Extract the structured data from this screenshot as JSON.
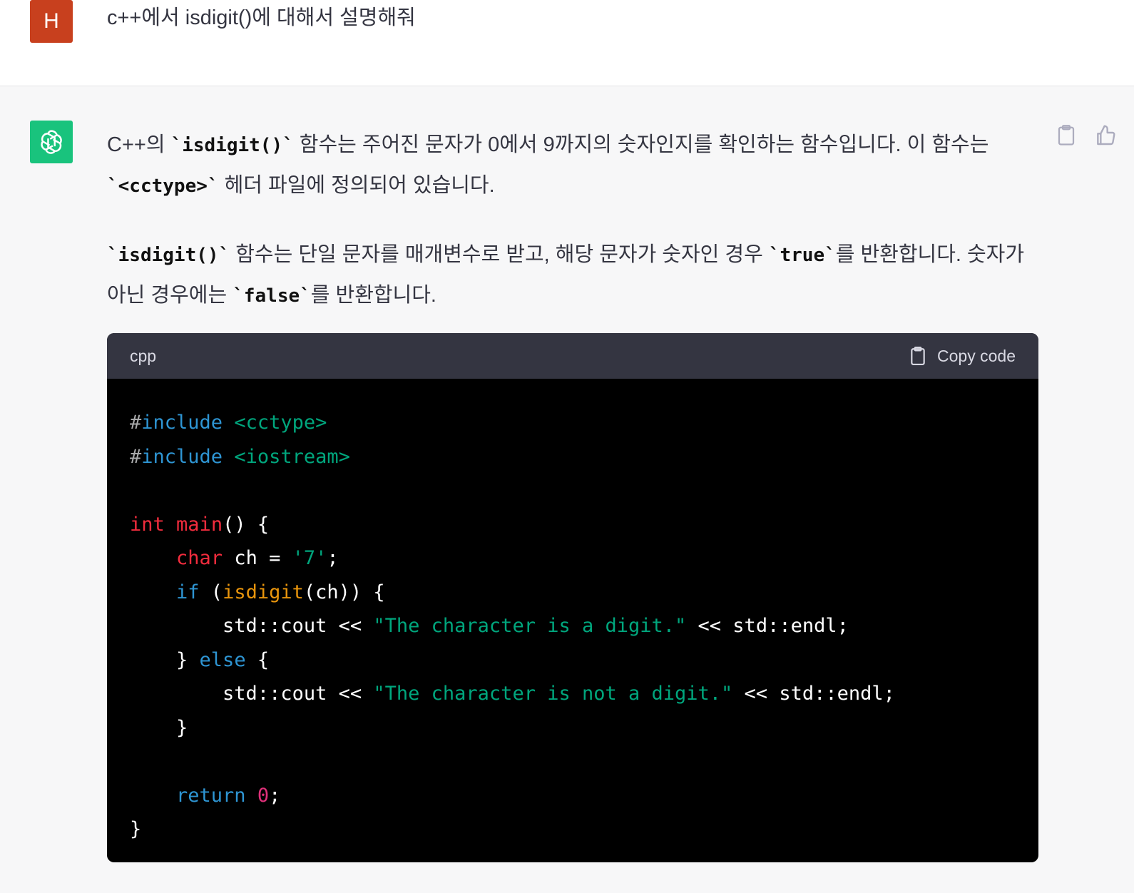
{
  "user": {
    "avatar_letter": "H",
    "message": "c++에서 isdigit()에 대해서 설명해줘"
  },
  "assistant": {
    "p1": {
      "a": "C++의 ",
      "code1": "`isdigit()`",
      "b": " 함수는 주어진 문자가 0에서 9까지의 숫자인지를 확인하는 함수입니다. 이 함수는 ",
      "code2": "`<cctype>`",
      "c": " 헤더 파일에 정의되어 있습니다."
    },
    "p2": {
      "code1": "`isdigit()`",
      "a": " 함수는 단일 문자를 매개변수로 받고, 해당 문자가 숫자인 경우 ",
      "code2": "`true`",
      "b": "를 반환합니다. 숫자가 아닌 경우에는 ",
      "code3": "`false`",
      "c": "를 반환합니다."
    }
  },
  "codeblock": {
    "language": "cpp",
    "copy_label": "Copy code",
    "lines": {
      "l1_dir": "include",
      "l1_hdr": "<cctype>",
      "l2_dir": "include",
      "l2_hdr": "<iostream>",
      "l4_type": "int",
      "l4_fn": "main",
      "l4_rest": "() {",
      "l5_type": "char",
      "l5_mid": " ch = ",
      "l5_str": "'7'",
      "l5_end": ";",
      "l6_kw": "if",
      "l6_a": " (",
      "l6_fn": "isdigit",
      "l6_b": "(ch)) {",
      "l7_a": "std::cout << ",
      "l7_str": "\"The character is a digit.\"",
      "l7_b": " << std::endl;",
      "l8_a": "} ",
      "l8_kw": "else",
      "l8_b": " {",
      "l9_a": "std::cout << ",
      "l9_str": "\"The character is not a digit.\"",
      "l9_b": " << std::endl;",
      "l10": "}",
      "l12_kw": "return",
      "l12_num": "0",
      "l12_end": ";",
      "l13": "}"
    }
  }
}
